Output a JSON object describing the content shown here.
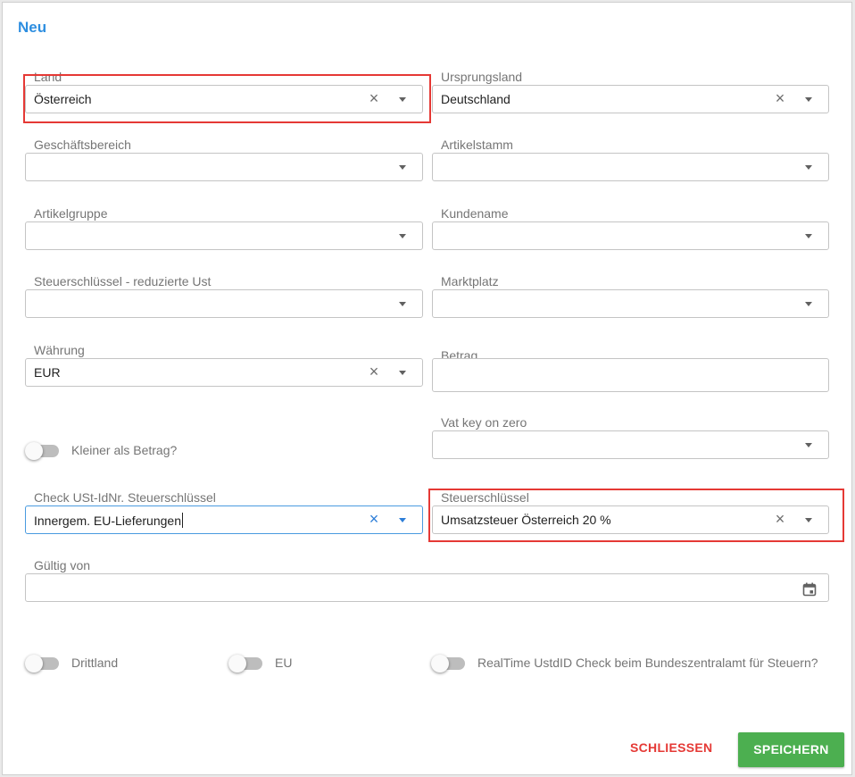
{
  "dialog": {
    "title": "Neu",
    "close_label": "SCHLIESSEN",
    "save_label": "SPEICHERN",
    "colors": {
      "accent": "#2d8ee0",
      "save": "#4caf50",
      "close": "#e53935",
      "highlight": "#e53935"
    }
  },
  "fields": {
    "land": {
      "label": "Land",
      "value": "Österreich"
    },
    "ursprungsland": {
      "label": "Ursprungsland",
      "value": "Deutschland"
    },
    "geschaeftsbereich": {
      "label": "Geschäftsbereich",
      "value": ""
    },
    "artikelstamm": {
      "label": "Artikelstamm",
      "value": ""
    },
    "artikelgruppe": {
      "label": "Artikelgruppe",
      "value": ""
    },
    "kundename": {
      "label": "Kundename",
      "value": ""
    },
    "steuerschluessel_reduziert": {
      "label": "Steuerschlüssel - reduzierte Ust",
      "value": ""
    },
    "marktplatz": {
      "label": "Marktplatz",
      "value": ""
    },
    "waehrung": {
      "label": "Währung",
      "value": "EUR"
    },
    "betrag": {
      "label": "Betrag",
      "value": ""
    },
    "vat_key_zero": {
      "label": "Vat key on zero",
      "value": ""
    },
    "check_ust": {
      "label": "Check USt-IdNr. Steuerschlüssel",
      "value": "Innergem. EU-Lieferungen"
    },
    "steuerschluessel": {
      "label": "Steuerschlüssel",
      "value": "Umsatzsteuer Österreich 20 %"
    },
    "gueltig_von": {
      "label": "Gültig von",
      "value": ""
    }
  },
  "toggles": {
    "kleiner_als_betrag": {
      "label": "Kleiner als Betrag?",
      "on": false
    },
    "drittland": {
      "label": "Drittland",
      "on": false
    },
    "eu": {
      "label": "EU",
      "on": false
    },
    "realtime_check": {
      "label": "RealTime UstdID Check beim Bundeszentralamt für Steuern?",
      "on": false
    }
  },
  "icons": {
    "clear": "close-icon",
    "dropdown": "chevron-down-icon",
    "calendar": "calendar-icon"
  }
}
